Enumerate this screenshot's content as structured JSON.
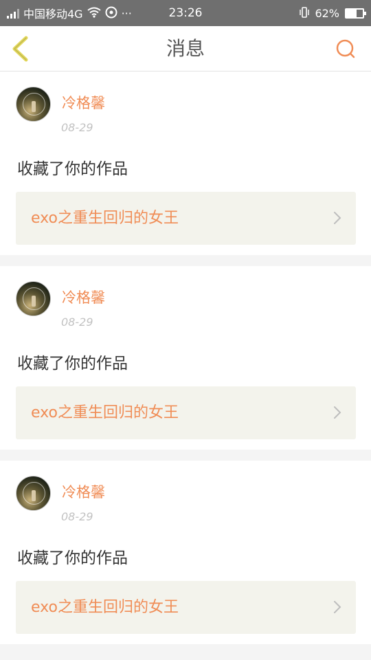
{
  "statusbar": {
    "carrier": "中国移动4G",
    "wifi_icon": "wifi-icon",
    "music_icon": "music-icon",
    "more": "···",
    "time": "23:26",
    "vibrate_icon": "vibrate-icon",
    "battery_percent": "62%",
    "battery_level": 0.62
  },
  "header": {
    "title": "消息",
    "back_icon": "back-chevron-icon",
    "search_icon": "search-icon"
  },
  "colors": {
    "accent": "#f08c55",
    "back_arrow": "#e2d75a",
    "statusbar_bg": "#6f6f6f"
  },
  "messages": [
    {
      "username": "冷格馨",
      "date": "08-29",
      "action": "收藏了你的作品",
      "work_title": "exo之重生回归的女王"
    },
    {
      "username": "冷格馨",
      "date": "08-29",
      "action": "收藏了你的作品",
      "work_title": "exo之重生回归的女王"
    },
    {
      "username": "冷格馨",
      "date": "08-29",
      "action": "收藏了你的作品",
      "work_title": "exo之重生回归的女王"
    }
  ]
}
